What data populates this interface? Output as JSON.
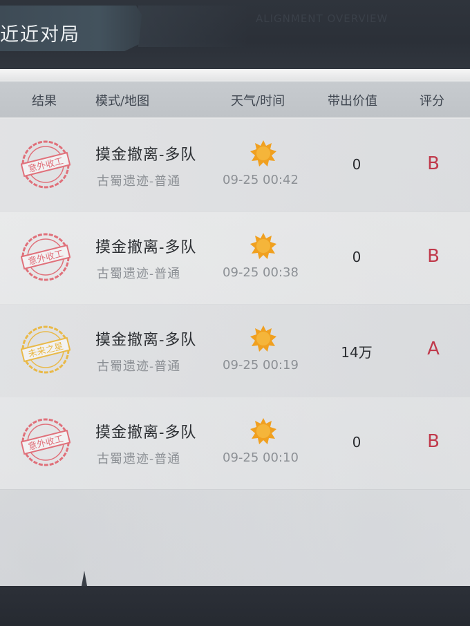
{
  "title": "近近对局",
  "top_faded_text": "ALIGNMENT  OVERVIEW",
  "columns": {
    "result": "结果",
    "mode_map": "模式/地图",
    "weather_time": "天气/时间",
    "value": "带出价值",
    "grade": "评分"
  },
  "colors": {
    "stamp_red": "#e0707a",
    "stamp_gold": "#e9b948",
    "grade_red": "#c0394b",
    "sun_orange": "#f0a020"
  },
  "matches": [
    {
      "stamp": "意外收工",
      "stamp_type": "red",
      "mode": "摸金撤离-多队",
      "map": "古蜀遗迹-普通",
      "weather_icon": "sun-icon",
      "time": "09-25 00:42",
      "value": "0",
      "grade": "B"
    },
    {
      "stamp": "意外收工",
      "stamp_type": "red",
      "mode": "摸金撤离-多队",
      "map": "古蜀遗迹-普通",
      "weather_icon": "sun-icon",
      "time": "09-25 00:38",
      "value": "0",
      "grade": "B"
    },
    {
      "stamp": "未来之星",
      "stamp_type": "gold",
      "mode": "摸金撤离-多队",
      "map": "古蜀遗迹-普通",
      "weather_icon": "sun-icon",
      "time": "09-25 00:19",
      "value": "14万",
      "grade": "A"
    },
    {
      "stamp": "意外收工",
      "stamp_type": "red",
      "mode": "摸金撤离-多队",
      "map": "古蜀遗迹-普通",
      "weather_icon": "sun-icon",
      "time": "09-25 00:10",
      "value": "0",
      "grade": "B"
    }
  ]
}
